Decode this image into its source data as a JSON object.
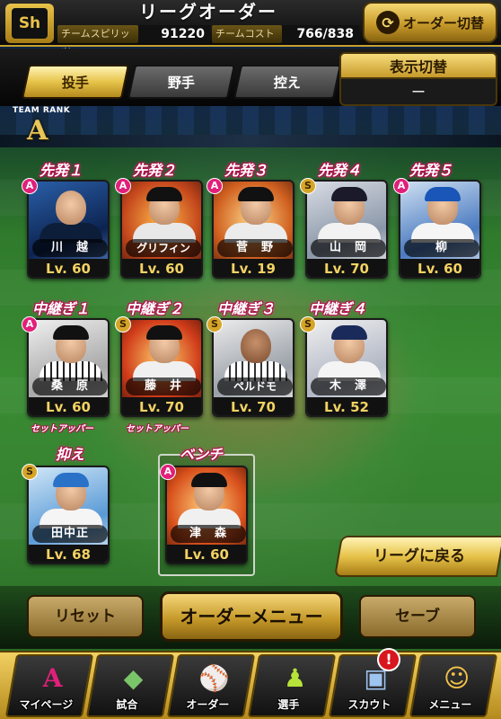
{
  "header": {
    "title": "リーグオーダー",
    "team_spirit_label": "チームスピリッツ",
    "team_spirit_value": "91220",
    "team_cost_label": "チームコスト",
    "team_cost_value": "766/838",
    "order_switch_label": "オーダー切替"
  },
  "tabs": [
    {
      "label": "投手",
      "active": true
    },
    {
      "label": "野手",
      "active": false
    },
    {
      "label": "控え",
      "active": false
    }
  ],
  "display_toggle": {
    "label": "表示切替",
    "value": "ー"
  },
  "team_rank": {
    "label": "TEAM RANK",
    "value": "A"
  },
  "pitchers": [
    {
      "slot": "先発１",
      "name": "川　越",
      "level": "Lv. 60",
      "rank": "A"
    },
    {
      "slot": "先発２",
      "name": "グリフィン",
      "level": "Lv. 60",
      "rank": "A"
    },
    {
      "slot": "先発３",
      "name": "菅　野",
      "level": "Lv. 19",
      "rank": "A"
    },
    {
      "slot": "先発４",
      "name": "山　岡",
      "level": "Lv. 70",
      "rank": "S"
    },
    {
      "slot": "先発５",
      "name": "柳",
      "level": "Lv. 60",
      "rank": "A"
    },
    {
      "slot": "中継ぎ１",
      "name": "桑　原",
      "level": "Lv. 60",
      "rank": "A",
      "sub": "セットアッパー"
    },
    {
      "slot": "中継ぎ２",
      "name": "藤　井",
      "level": "Lv. 70",
      "rank": "S",
      "sub": "セットアッパー"
    },
    {
      "slot": "中継ぎ３",
      "name": "ペルドモ",
      "level": "Lv. 70",
      "rank": "S"
    },
    {
      "slot": "中継ぎ４",
      "name": "木　澤",
      "level": "Lv. 52",
      "rank": "S"
    },
    {
      "slot": "抑え",
      "name": "田中正",
      "level": "Lv. 68",
      "rank": "S"
    },
    {
      "slot": "ベンチ",
      "name": "津　森",
      "level": "Lv. 60",
      "rank": "A"
    }
  ],
  "buttons": {
    "back_to_league": "リーグに戻る",
    "reset": "リセット",
    "order_menu": "オーダーメニュー",
    "save": "セーブ"
  },
  "nav": [
    {
      "label": "マイページ",
      "icon": "mypage-icon"
    },
    {
      "label": "試合",
      "icon": "stadium-icon"
    },
    {
      "label": "オーダー",
      "icon": "lineup-icon"
    },
    {
      "label": "選手",
      "icon": "player-icon"
    },
    {
      "label": "スカウト",
      "icon": "scout-icon"
    },
    {
      "label": "メニュー",
      "icon": "menu-icon"
    }
  ],
  "notification_badge": "!",
  "team_logo_text": "Sh",
  "colors": {
    "accent_gold": "#e6c34a",
    "slot_label_pink": "#b0104a",
    "rank_a": "#e0207a",
    "rank_s": "#d6a528"
  }
}
